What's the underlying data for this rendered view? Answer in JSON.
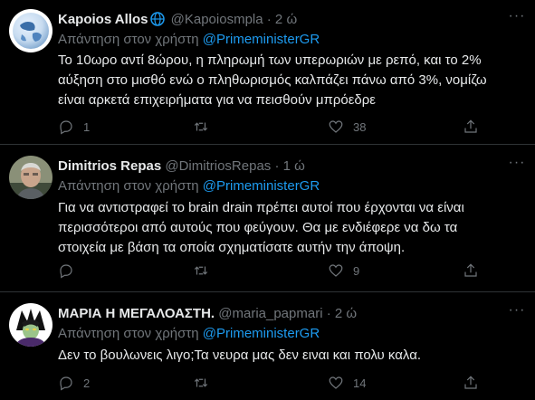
{
  "tweets": [
    {
      "name": "Kapoios Allos",
      "handle": "@Kapoiosmpla",
      "time": "· 2 ώ",
      "reply_prefix": "Απάντηση στον χρήστη",
      "reply_to": "@PrimeministerGR",
      "lines": [
        "Το 10ωρο αντί 8ώρου, η πληρωμή των υπερωριών με ρεπό, και το 2%",
        "αύξηση στο μισθό ενώ ο πληθωρισμός καλπάζει πάνω από 3%,  νομίζω",
        "είναι αρκετά επιχειρήματα για να πεισθούν μπρόεδρε"
      ],
      "replies": "1",
      "retweets": "",
      "likes": "38"
    },
    {
      "name": "Dimitrios Repas",
      "handle": "@DimitriosRepas",
      "time": "· 1 ώ",
      "reply_prefix": "Απάντηση στον χρήστη",
      "reply_to": "@PrimeministerGR",
      "lines": [
        "Για να αντιστραφεί το brain drain πρέπει αυτοί που έρχονται να είναι",
        "περισσότεροι από αυτούς που φεύγουν. Θα με ενδιέφερε να δω τα",
        "στοιχεία με βάση τα οποία σχηματίσατε αυτήν την άποψη."
      ],
      "replies": "",
      "retweets": "",
      "likes": "9"
    },
    {
      "name": "ΜΑΡΙΑ Η ΜΕΓΑΛΟΑΣΤΗ.",
      "handle": "@maria_papmari",
      "time": "· 2 ώ",
      "reply_prefix": "Απάντηση στον χρήστη",
      "reply_to": "@PrimeministerGR",
      "lines": [
        "Δεν το βουλωνεις λιγο;Τα νευρα μας δεν ειναι και πολυ καλα."
      ],
      "replies": "2",
      "retweets": "",
      "likes": "14"
    }
  ],
  "colors": {
    "background": "#000000",
    "text": "#e7e9ea",
    "secondary": "#71767b",
    "link": "#1d9bf0",
    "divider": "#2f3336"
  },
  "icons": {
    "more": "more-dots-icon",
    "reply": "reply-bubble-icon",
    "retweet": "retweet-icon",
    "like": "heart-icon",
    "share": "share-icon",
    "verified": "globe-badge-icon"
  }
}
